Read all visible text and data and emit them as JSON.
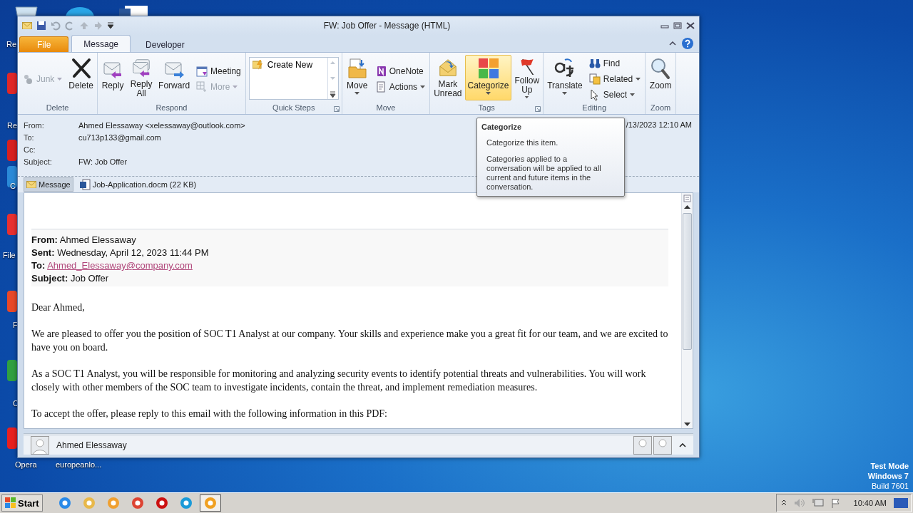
{
  "window": {
    "title": "FW:  Job Offer - Message (HTML)"
  },
  "ribbon_tabs": [
    {
      "label": "File",
      "kind": "file",
      "selected": false
    },
    {
      "label": "Message",
      "kind": "tab",
      "selected": true
    },
    {
      "label": "Developer",
      "kind": "tab",
      "selected": false
    }
  ],
  "ribbon_groups": [
    {
      "label": "Delete",
      "launcher": false,
      "items": [
        {
          "kind": "stack",
          "items": [
            {
              "label": "Junk",
              "disabled": true,
              "dropdown": true
            }
          ]
        },
        {
          "kind": "large",
          "label": "Delete",
          "disabled": false,
          "dropdown": false,
          "highlighted": false
        }
      ]
    },
    {
      "label": "Respond",
      "launcher": false,
      "items": [
        {
          "kind": "large",
          "label": "Reply",
          "disabled": false,
          "dropdown": false,
          "highlighted": false
        },
        {
          "kind": "large",
          "label": "Reply All",
          "disabled": false,
          "dropdown": false,
          "highlighted": false
        },
        {
          "kind": "large",
          "label": "Forward",
          "disabled": false,
          "dropdown": false,
          "highlighted": false
        },
        {
          "kind": "stack",
          "items": [
            {
              "label": "Meeting",
              "disabled": false,
              "dropdown": false
            },
            {
              "label": "More",
              "disabled": true,
              "dropdown": true
            }
          ]
        }
      ]
    },
    {
      "label": "Quick Steps",
      "launcher": true,
      "items": [
        {
          "kind": "gallery",
          "items": [
            {
              "label": "Create New"
            }
          ]
        }
      ]
    },
    {
      "label": "Move",
      "launcher": false,
      "items": [
        {
          "kind": "large",
          "label": "Move",
          "disabled": false,
          "dropdown": true,
          "highlighted": false
        },
        {
          "kind": "stack",
          "items": [
            {
              "label": "OneNote",
              "disabled": false,
              "dropdown": false
            },
            {
              "label": "Actions",
              "disabled": false,
              "dropdown": true
            }
          ]
        }
      ]
    },
    {
      "label": "Tags",
      "launcher": true,
      "items": [
        {
          "kind": "large",
          "label": "Mark Unread",
          "disabled": false,
          "dropdown": false,
          "highlighted": false
        },
        {
          "kind": "large",
          "label": "Categorize",
          "disabled": false,
          "dropdown": true,
          "highlighted": true
        },
        {
          "kind": "large",
          "label": "Follow Up",
          "disabled": false,
          "dropdown": true,
          "highlighted": false
        }
      ]
    },
    {
      "label": "Editing",
      "launcher": false,
      "items": [
        {
          "kind": "large",
          "label": "Translate",
          "disabled": false,
          "dropdown": true,
          "highlighted": false
        },
        {
          "kind": "stack",
          "items": [
            {
              "label": "Find",
              "disabled": false,
              "dropdown": false
            },
            {
              "label": "Related",
              "disabled": false,
              "dropdown": true
            },
            {
              "label": "Select",
              "disabled": false,
              "dropdown": true
            }
          ]
        }
      ]
    },
    {
      "label": "Zoom",
      "launcher": false,
      "items": [
        {
          "kind": "large",
          "label": "Zoom",
          "disabled": false,
          "dropdown": false,
          "highlighted": false
        }
      ]
    }
  ],
  "header_fields": [
    {
      "label": "From:",
      "value": "Ahmed Elessaway <xelessaway@outlook.com>"
    },
    {
      "label": "To:",
      "value": "cu713p133@gmail.com"
    },
    {
      "label": "Cc:"
    },
    {
      "label": "Subject:",
      "value": "FW:  Job Offer"
    }
  ],
  "sent": "/13/2023 12:10 AM",
  "attachments": [
    {
      "label": "Message",
      "kind": "message",
      "selected": true
    },
    {
      "label": "Job-Application.docm (22 KB)",
      "kind": "file",
      "selected": false
    }
  ],
  "forwarded_header": [
    {
      "label": "From:",
      "value": "Ahmed Elessaway",
      "kind": "text"
    },
    {
      "label": "Sent:",
      "value": "Wednesday, April 12, 2023 11:44 PM",
      "kind": "text"
    },
    {
      "label": "To:",
      "value": "Ahmed_Elessaway@company.com",
      "kind": "link"
    },
    {
      "label": "Subject:",
      "value": "Job Offer",
      "kind": "text"
    }
  ],
  "paragraphs": [
    "Dear Ahmed,",
    "We are pleased to offer you the position of SOC T1 Analyst at our company. Your skills and experience make you a great fit for our team, and we are excited to have you on board.",
    "As a SOC T1 Analyst, you will be responsible for monitoring and analyzing security events to identify potential threats and vulnerabilities. You will work closely with other members of the SOC team to investigate incidents, contain the threat, and implement remediation measures.",
    "To accept the offer, please reply to this email with the following information in this PDF:"
  ],
  "people_pane": {
    "name": "Ahmed Elessaway"
  },
  "tooltip": {
    "title": "Categorize",
    "lines": [
      "Categorize this item.",
      "Categories applied to a conversation will be applied to all current and future items in the conversation."
    ]
  },
  "desktop_icons": [
    {
      "label": "Re"
    },
    {
      "label": "Re"
    },
    {
      "label": "C"
    },
    {
      "label": "File"
    },
    {
      "label": "F"
    },
    {
      "label": "C"
    },
    {
      "label": "Opera"
    },
    {
      "label": "europeanlo..."
    }
  ],
  "os_notice": [
    "Test Mode",
    "Windows 7",
    "Build 7601"
  ],
  "taskbar": {
    "start": "Start",
    "apps": [
      {
        "selected": false
      },
      {
        "selected": false
      },
      {
        "selected": false
      },
      {
        "selected": false
      },
      {
        "selected": false
      },
      {
        "selected": false
      },
      {
        "selected": true
      }
    ],
    "clock": "10:40 AM"
  }
}
